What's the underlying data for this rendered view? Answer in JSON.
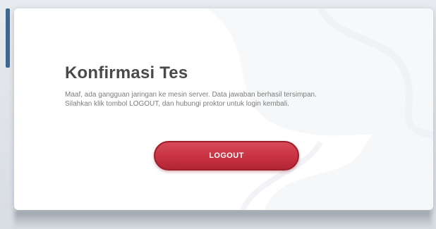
{
  "dialog": {
    "title": "Konfirmasi Tes",
    "message_line_1": "Maaf, ada gangguan jaringan ke mesin server. Data jawaban berhasil tersimpan.",
    "message_line_2": "Silahkan klik tombol LOGOUT, dan hubungi proktor untuk login kembali.",
    "logout_label": "LOGOUT"
  },
  "colors": {
    "accent": "#3c6894",
    "button": "#c6303f"
  }
}
